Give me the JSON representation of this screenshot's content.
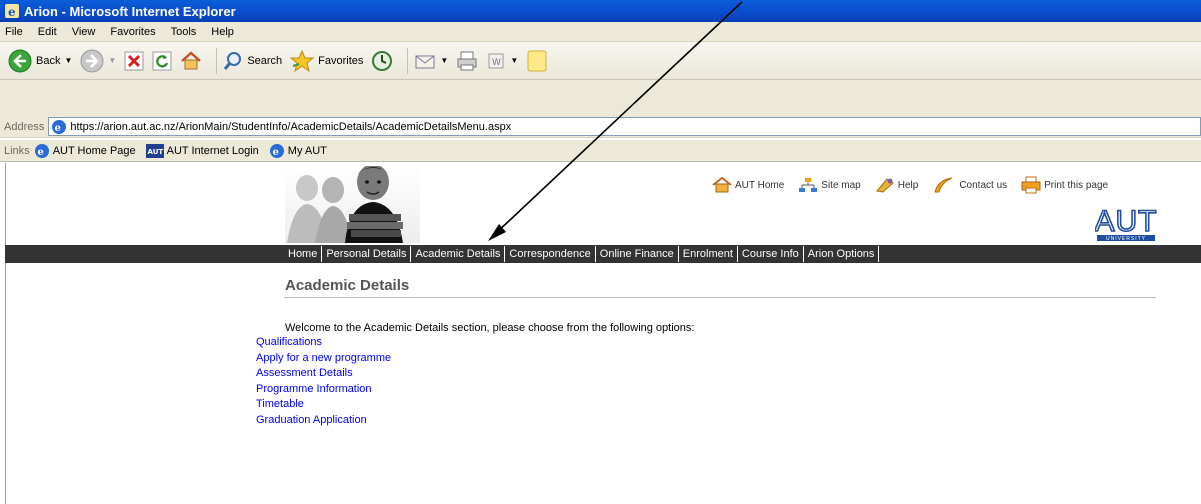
{
  "window": {
    "title": "Arion - Microsoft Internet Explorer"
  },
  "menu": [
    "File",
    "Edit",
    "View",
    "Favorites",
    "Tools",
    "Help"
  ],
  "toolbar": {
    "back_label": "Back",
    "search_label": "Search",
    "favorites_label": "Favorites"
  },
  "address": {
    "label": "Address",
    "url": "https://arion.aut.ac.nz/ArionMain/StudentInfo/AcademicDetails/AcademicDetailsMenu.aspx"
  },
  "links": {
    "label": "Links",
    "items": [
      "AUT Home Page",
      "AUT Internet Login",
      "My AUT"
    ]
  },
  "top_links": [
    "AUT Home",
    "Site map",
    "Help",
    "Contact us",
    "Print this page"
  ],
  "logo": {
    "text": "AUT",
    "subtext": "UNIVERSITY"
  },
  "nav": [
    "Home",
    "Personal Details",
    "Academic Details",
    "Correspondence",
    "Online Finance",
    "Enrolment",
    "Course Info",
    "Arion Options"
  ],
  "content": {
    "heading": "Academic Details",
    "welcome": "Welcome to the Academic Details section, please choose from the following options:",
    "options": [
      "Qualifications",
      "Apply for a new programme",
      "Assessment Details",
      "Programme Information",
      "Timetable",
      "Graduation Application"
    ]
  },
  "colors": {
    "titlebar": "#0a5ed8",
    "navbar": "#333333",
    "link": "#0000ee",
    "heading": "#555555"
  }
}
